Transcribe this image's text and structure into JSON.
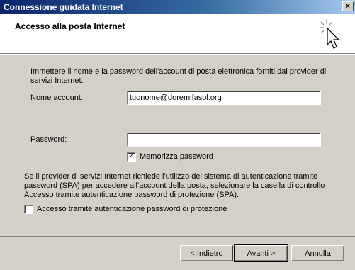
{
  "window": {
    "title": "Connessione guidata Internet",
    "close_label": "×"
  },
  "header": {
    "heading": "Accesso alla posta Internet",
    "icon": "wizard-cursor-icon"
  },
  "form": {
    "intro": "Immettere il nome e la password dell'account di posta elettronica forniti dal provider di servizi Internet.",
    "account_label": "Nome account:",
    "account_value": "tuonome@doremifasol.org",
    "password_label": "Password:",
    "password_value": "",
    "remember_label": "Memorizza password",
    "remember_checked": true,
    "spa_info": "Se il provider di servizi Internet richiede l'utilizzo del sistema di autenticazione tramite password (SPA) per accedere all'account della posta, selezionare la casella di controllo Accesso tramite autenticazione password di protezione (SPA).",
    "spa_label": "Accesso tramite autenticazione password di protezione",
    "spa_checked": false
  },
  "buttons": {
    "back": "< Indietro",
    "next": "Avanti >",
    "cancel": "Annulla"
  }
}
